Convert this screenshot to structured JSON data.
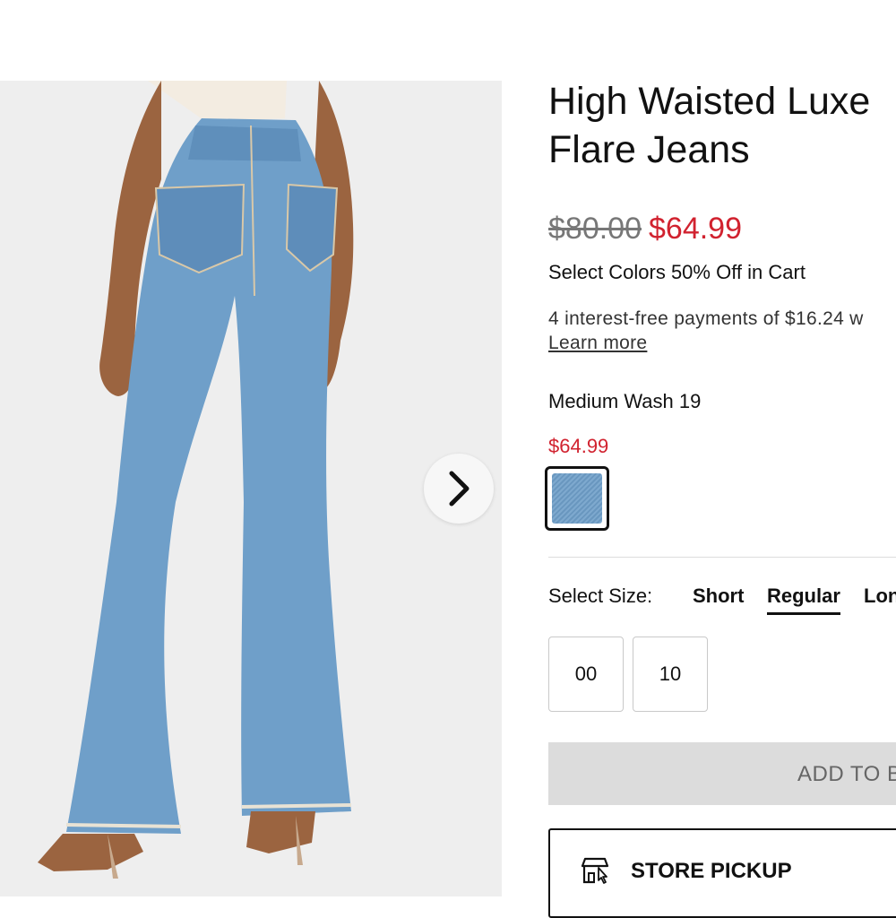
{
  "product": {
    "title_line1": "High Waisted Luxe",
    "title_line2": "Flare Jeans",
    "original_price": "$80.00",
    "sale_price": "$64.99",
    "promo": "Select Colors 50% Off in Cart",
    "installments": "4 interest-free payments of $16.24 w",
    "learn_more": "Learn more",
    "color_name": "Medium Wash 19",
    "color_price": "$64.99"
  },
  "gallery": {
    "next_icon": "chevron-right-icon",
    "image_subject": "jeans-model-back-view"
  },
  "size": {
    "label": "Select Size:",
    "fits": [
      "Short",
      "Regular",
      "Lon"
    ],
    "selected_fit": "Regular",
    "options": [
      "00",
      "10"
    ]
  },
  "actions": {
    "add_to_bag": "ADD TO B",
    "store_pickup": "STORE PICKUP",
    "store_pickup_icon": "store-pickup-icon"
  },
  "colors": {
    "sale_red": "#d1222f",
    "denim": "#6f9fc9"
  }
}
